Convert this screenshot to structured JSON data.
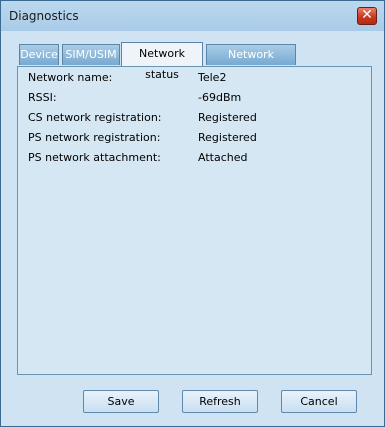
{
  "window": {
    "title": "Diagnostics",
    "close_glyph": "✕"
  },
  "tabs": [
    {
      "label": "Device",
      "active": false
    },
    {
      "label": "SIM/USIM",
      "active": false
    },
    {
      "label": "Network status",
      "active": true
    },
    {
      "label": "Network settings",
      "active": false
    }
  ],
  "status": [
    {
      "label": "Network name:",
      "value": "Tele2"
    },
    {
      "label": "RSSI:",
      "value": "-69dBm"
    },
    {
      "label": "CS network registration:",
      "value": "Registered"
    },
    {
      "label": "PS network registration:",
      "value": "Registered"
    },
    {
      "label": "PS network attachment:",
      "value": "Attached"
    }
  ],
  "buttons": {
    "save": "Save",
    "refresh": "Refresh",
    "cancel": "Cancel"
  }
}
